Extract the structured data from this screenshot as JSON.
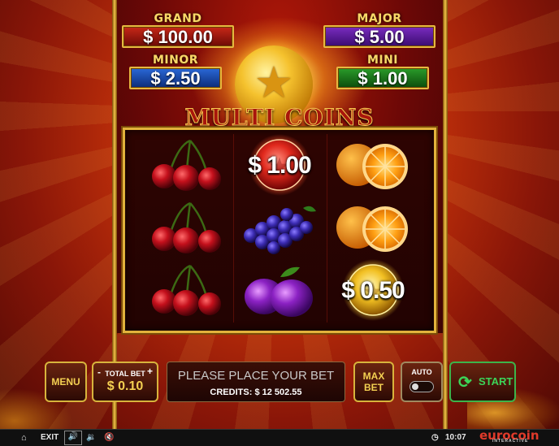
{
  "jackpots": {
    "grand": {
      "label": "GRAND",
      "value": "$ 100.00"
    },
    "major": {
      "label": "MAJOR",
      "value": "$ 5.00"
    },
    "minor": {
      "label": "MINOR",
      "value": "$ 2.50"
    },
    "mini": {
      "label": "MINI",
      "value": "$ 1.00"
    }
  },
  "logo": {
    "text": "MULTI COINS"
  },
  "reels": [
    [
      "cherries",
      "cherries",
      "cherries"
    ],
    [
      "coin-red",
      "grapes",
      "plums"
    ],
    [
      "orange",
      "orange",
      "coin-gold"
    ]
  ],
  "coins": {
    "red_value": "$ 1.00",
    "gold_value": "$ 0.50"
  },
  "controls": {
    "menu_label": "MENU",
    "total_bet_label": "TOTAL BET",
    "total_bet_value": "$ 0.10",
    "minus": "-",
    "plus": "+",
    "message": "PLEASE PLACE YOUR BET",
    "credits_label": "CREDITS:",
    "credits_value": "$ 12 502.55",
    "max_bet_line1": "MAX",
    "max_bet_line2": "BET",
    "auto_label": "AUTO",
    "start_label": "START"
  },
  "bottom_bar": {
    "exit_label": "EXIT",
    "clock": "10:07",
    "brand": "eurocoin",
    "brand_sub": "INTERACTIVE"
  },
  "colors": {
    "gold": "#e6b840",
    "start_green": "#3cb44a"
  }
}
